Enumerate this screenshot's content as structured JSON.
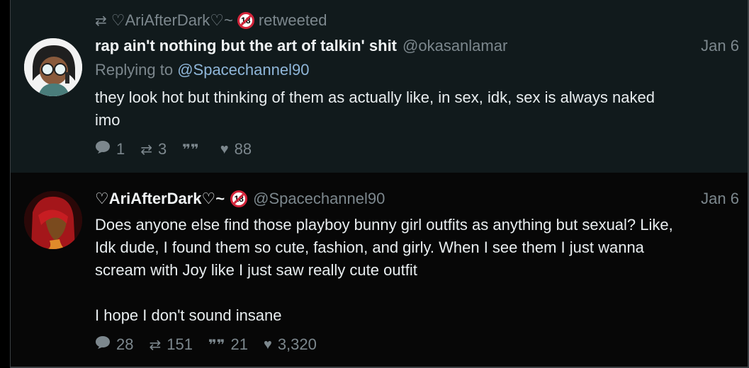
{
  "retweet": {
    "label": "♡AriAfterDark♡~",
    "suffix": "retweeted"
  },
  "tweets": [
    {
      "name": "rap ain't nothing but the art of talkin' shit",
      "handle": "@okasanlamar",
      "date": "Jan 6",
      "replying_prefix": "Replying to",
      "replying_to": "@Spacechannel90",
      "text": "they look hot but thinking of them as actually like, in sex, idk, sex is always naked\nimo",
      "replies": "1",
      "retweets": "3",
      "quotes": "",
      "likes": "88"
    },
    {
      "name": "♡AriAfterDark♡~",
      "handle": "@Spacechannel90",
      "date": "Jan 6",
      "text": "Does anyone else find those playboy bunny girl outfits as anything but sexual? Like,\nIdk dude, I found them so cute, fashion, and girly. When I see them I just wanna\nscream with Joy like I just saw really cute outfit\n\nI hope I don't sound insane",
      "replies": "28",
      "retweets": "151",
      "quotes": "21",
      "likes": "3,320"
    }
  ],
  "colors": {
    "background": "#000000",
    "tweet1_bg": "#111a1c",
    "muted": "#7c878d",
    "mention": "#8fb6d9",
    "badge_red": "#d2243a"
  },
  "icons": {
    "retweet": "retweet-icon",
    "reply": "reply-icon",
    "quote": "quote-icon",
    "like": "heart-icon",
    "badge": "18-badge-icon"
  }
}
